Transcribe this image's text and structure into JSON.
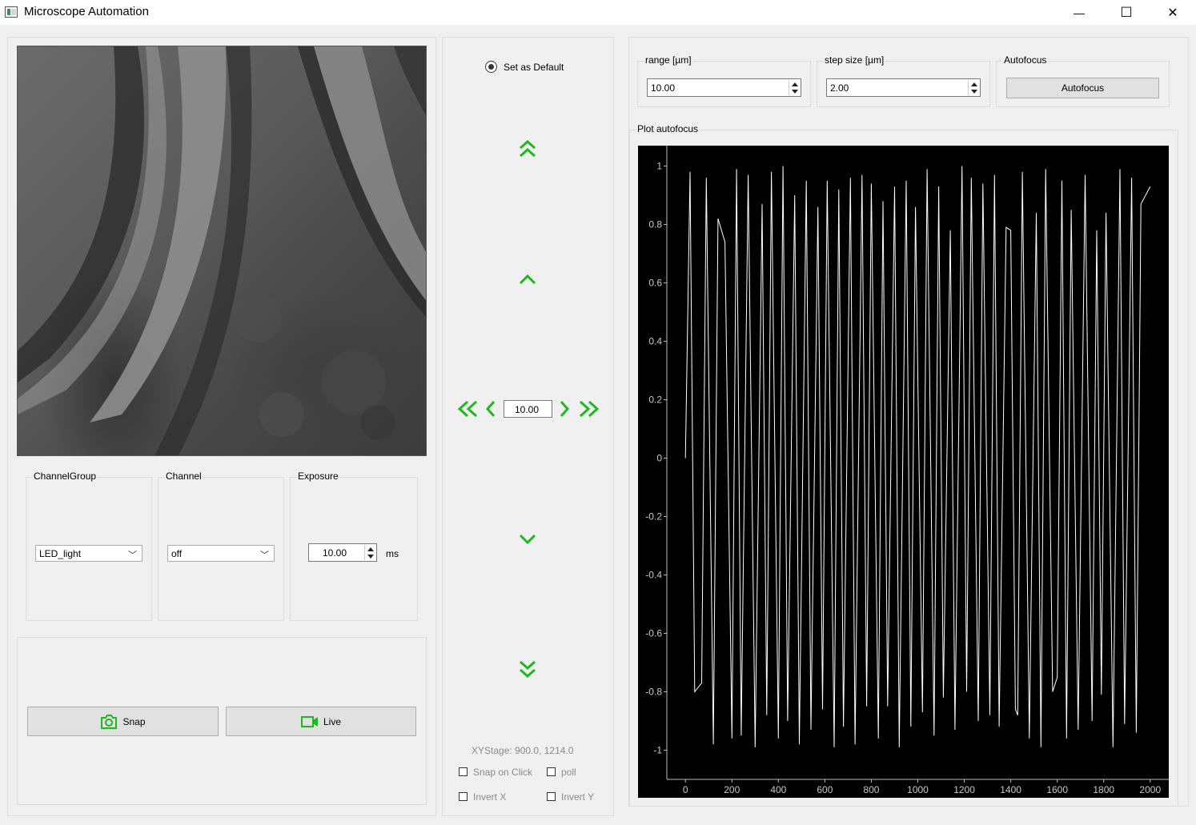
{
  "window": {
    "title": "Microscope Automation",
    "minimize_glyph": "—",
    "maximize_glyph": "☐",
    "close_glyph": "✕"
  },
  "channel_group": {
    "title": "ChannelGroup",
    "value": "LED_light",
    "icon": "chevron-down-icon"
  },
  "channel": {
    "title": "Channel",
    "value": "off",
    "icon": "chevron-down-icon"
  },
  "exposure": {
    "title": "Exposure",
    "value": "10.00",
    "unit": "ms"
  },
  "actions": {
    "snap_label": "Snap",
    "live_label": "Live",
    "snap_icon": "camera-icon",
    "live_icon": "video-camera-icon"
  },
  "stage": {
    "set_default_label": "Set as Default",
    "step_value": "10.00",
    "status": "XYStage:  900.0, 1214.0",
    "snap_on_click_label": "Snap on Click",
    "poll_label": "poll",
    "invert_x_label": "Invert X",
    "invert_y_label": "Invert Y",
    "accent_color": "#1fb81f"
  },
  "autofocus": {
    "range_title": "range [µm]",
    "range_value": "10.00",
    "step_title": "step size [µm]",
    "step_value": "2.00",
    "group_title": "Autofocus",
    "button_label": "Autofocus",
    "plot_title": "Plot autofocus"
  },
  "chart_data": {
    "type": "line",
    "title": "",
    "xlabel": "",
    "ylabel": "",
    "xlim": [
      -80,
      2080
    ],
    "ylim": [
      -1.1,
      1.07
    ],
    "x_ticks": [
      0,
      200,
      400,
      600,
      800,
      1000,
      1200,
      1400,
      1600,
      1800,
      2000
    ],
    "y_ticks": [
      1,
      0.8,
      0.6,
      0.4,
      0.2,
      0,
      -0.2,
      -0.4,
      -0.6,
      -0.8,
      -1
    ],
    "y_tick_labels": [
      "1",
      "0.8",
      "0.6",
      "0.4",
      "0.2",
      "0",
      "-0.2",
      "-0.4",
      "-0.6",
      "-0.8",
      "-1"
    ],
    "grid": false,
    "line_color": "#ffffff",
    "background": "#000000",
    "series": [
      {
        "x": [
          0,
          20,
          40,
          70,
          90,
          120,
          140,
          170,
          200,
          220,
          240,
          270,
          300,
          330,
          350,
          370,
          400,
          420,
          440,
          470,
          490,
          520,
          540,
          570,
          590,
          610,
          640,
          660,
          680,
          710,
          730,
          760,
          780,
          800,
          830,
          850,
          870,
          900,
          920,
          950,
          970,
          990,
          1020,
          1040,
          1070,
          1090,
          1110,
          1140,
          1160,
          1190,
          1210,
          1230,
          1260,
          1280,
          1310,
          1330,
          1350,
          1380,
          1400,
          1420,
          1430,
          1450,
          1480,
          1510,
          1530,
          1550,
          1580,
          1600,
          1620,
          1640,
          1660,
          1690,
          1720,
          1750,
          1770,
          1790,
          1810,
          1840,
          1870,
          1890,
          1920,
          1940,
          1960,
          2000
        ],
        "y": [
          0,
          0.98,
          -0.8,
          -0.77,
          0.96,
          -0.98,
          0.82,
          0.74,
          -0.96,
          0.99,
          -0.95,
          0.97,
          -0.99,
          0.87,
          -0.88,
          0.98,
          -0.96,
          1.0,
          -0.9,
          0.9,
          -0.98,
          0.95,
          -0.93,
          0.86,
          -0.86,
          0.95,
          -0.99,
          0.92,
          -0.92,
          0.96,
          -0.98,
          0.97,
          -0.85,
          0.94,
          -0.96,
          0.88,
          -0.85,
          0.93,
          -0.99,
          0.95,
          -0.92,
          0.86,
          -0.87,
          0.99,
          -0.95,
          0.93,
          -0.82,
          0.78,
          -0.93,
          1.0,
          -0.8,
          0.96,
          -0.9,
          0.94,
          -0.88,
          0.97,
          -0.92,
          0.79,
          0.78,
          -0.86,
          -0.88,
          0.98,
          -0.96,
          0.84,
          -0.99,
          0.99,
          -0.8,
          -0.75,
          0.95,
          -0.96,
          0.85,
          -0.93,
          0.97,
          -0.9,
          0.78,
          -0.81,
          0.84,
          -0.99,
          0.99,
          -0.91,
          0.96,
          -0.94,
          0.87,
          0.93
        ]
      }
    ]
  }
}
